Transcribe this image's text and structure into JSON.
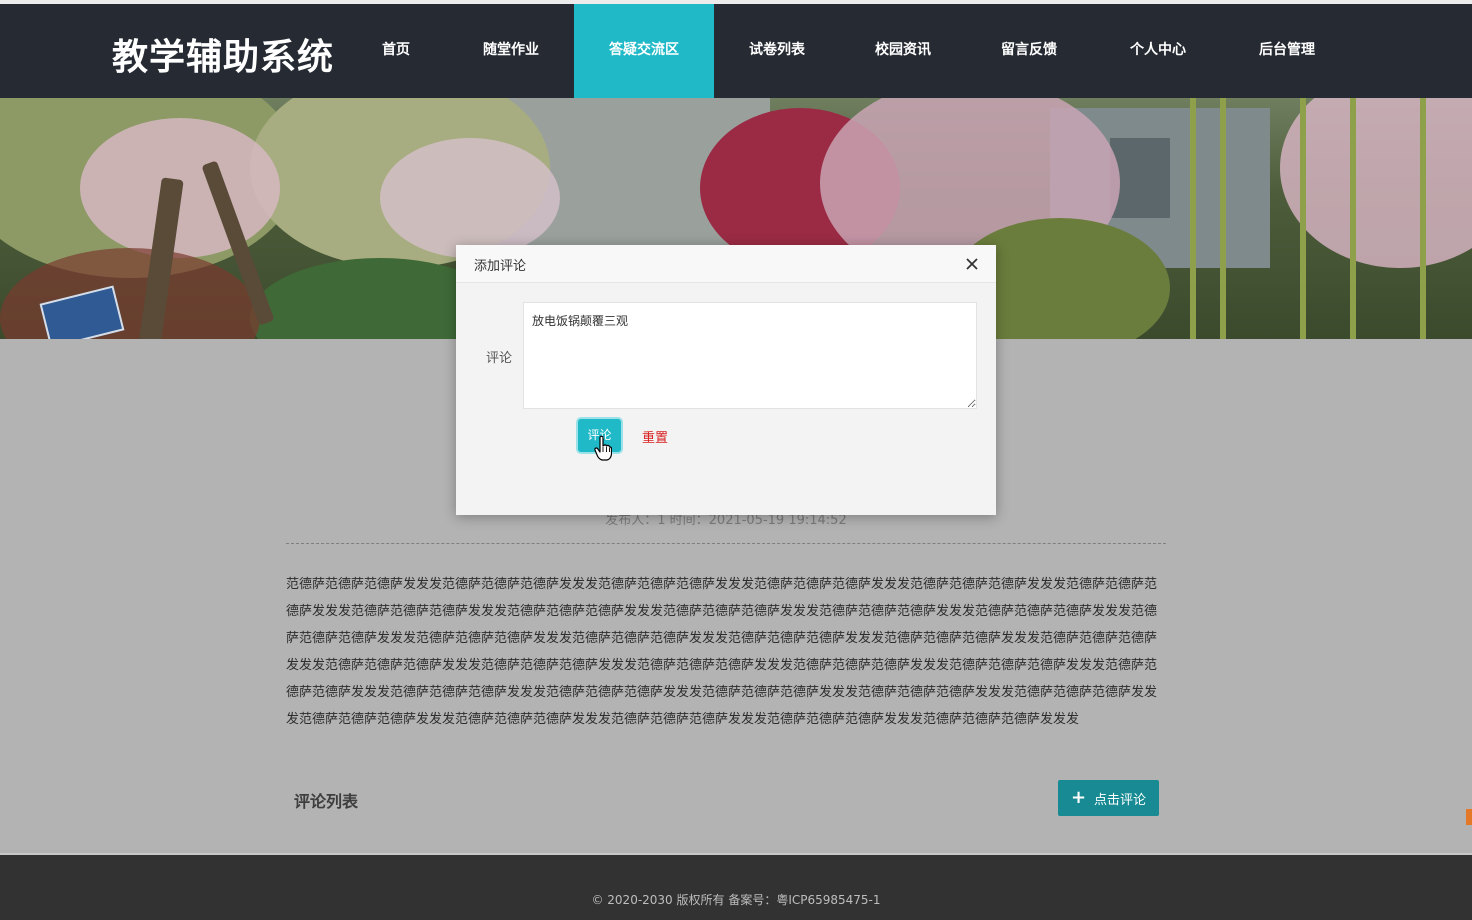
{
  "brand": "教学辅助系统",
  "nav": [
    {
      "label": "首页",
      "active": false
    },
    {
      "label": "随堂作业",
      "active": false
    },
    {
      "label": "答疑交流区",
      "active": true
    },
    {
      "label": "试卷列表",
      "active": false
    },
    {
      "label": "校园资讯",
      "active": false
    },
    {
      "label": "留言反馈",
      "active": false
    },
    {
      "label": "个人中心",
      "active": false
    },
    {
      "label": "后台管理",
      "active": false
    }
  ],
  "article": {
    "meta": "发布人：1 时间：2021-05-19 19:14:52",
    "body": "范德萨范德萨范德萨发发发范德萨范德萨范德萨发发发范德萨范德萨范德萨发发发范德萨范德萨范德萨发发发范德萨范德萨范德萨发发发范德萨范德萨范德萨发发发范德萨范德萨范德萨发发发范德萨范德萨范德萨发发发范德萨范德萨范德萨发发发范德萨范德萨范德萨发发发范德萨范德萨范德萨发发发范德萨范德萨范德萨发发发范德萨范德萨范德萨发发发范德萨范德萨范德萨发发发范德萨范德萨范德萨发发发范德萨范德萨范德萨发发发范德萨范德萨范德萨发发发范德萨范德萨范德萨发发发范德萨范德萨范德萨发发发范德萨范德萨范德萨发发发范德萨范德萨范德萨发发发范德萨范德萨范德萨发发发范德萨范德萨范德萨发发发范德萨范德萨范德萨发发发范德萨范德萨范德萨发发发范德萨范德萨范德萨发发发范德萨范德萨范德萨发发发范德萨范德萨范德萨发发发范德萨范德萨范德萨发发发范德萨范德萨范德萨发发发范德萨范德萨范德萨发发发范德萨范德萨范德萨发发发范德萨范德萨范德萨发发发"
  },
  "comments": {
    "title": "评论列表",
    "add_button": "点击评论",
    "add_icon": "+"
  },
  "footer": {
    "text": "© 2020-2030 版权所有 备案号：粤ICP65985475-1"
  },
  "modal": {
    "title": "添加评论",
    "close_icon": "close-icon",
    "field_label": "评论",
    "field_value": "放电饭锅颠覆三观",
    "submit_label": "评论",
    "reset_label": "重置"
  },
  "colors": {
    "nav_bg": "#262a33",
    "accent": "#1fb9c7",
    "button_dark": "#178a93",
    "reset_red": "#d7201f",
    "footer_bg": "#323232"
  }
}
